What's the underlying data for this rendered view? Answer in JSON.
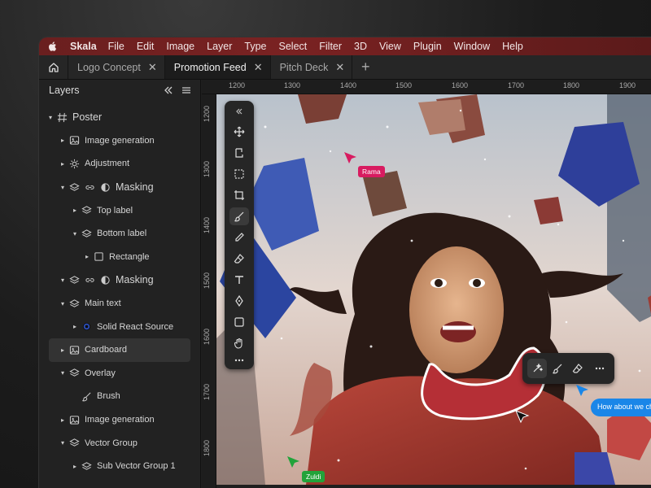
{
  "menubar": {
    "brand": "Skala",
    "items": [
      "File",
      "Edit",
      "Image",
      "Layer",
      "Type",
      "Select",
      "Filter",
      "3D",
      "View",
      "Plugin",
      "Window",
      "Help"
    ]
  },
  "tabs": [
    {
      "label": "Logo Concept",
      "active": false
    },
    {
      "label": "Promotion Feed",
      "active": true
    },
    {
      "label": "Pitch Deck",
      "active": false
    }
  ],
  "layers_panel": {
    "title": "Layers",
    "items": [
      {
        "label": "Poster",
        "icon": "hash-icon",
        "indent": 0,
        "caret": "▾"
      },
      {
        "label": "Image generation",
        "icon": "image-icon",
        "indent": 1,
        "caret": "▸"
      },
      {
        "label": "Adjustment",
        "icon": "sun-icon",
        "indent": 1,
        "caret": "▸"
      },
      {
        "label": "Masking",
        "icon": "mask-icon",
        "indent": 1,
        "caret": "▾"
      },
      {
        "label": "Top label",
        "icon": "stack-icon",
        "indent": 2,
        "caret": "▸"
      },
      {
        "label": "Bottom label",
        "icon": "stack-icon",
        "indent": 2,
        "caret": "▾"
      },
      {
        "label": "Rectangle",
        "icon": "square-icon",
        "indent": 3,
        "caret": "▸"
      },
      {
        "label": "Masking",
        "icon": "mask-icon",
        "indent": 1,
        "caret": "▾"
      },
      {
        "label": "Main text",
        "icon": "stack-icon",
        "indent": 1,
        "caret": "▾"
      },
      {
        "label": "Solid React Source",
        "icon": "dot-icon",
        "indent": 2,
        "caret": "▸"
      },
      {
        "label": "Cardboard",
        "icon": "image-icon",
        "indent": 1,
        "caret": "▸"
      },
      {
        "label": "Overlay",
        "icon": "stack-icon",
        "indent": 1,
        "caret": "▾"
      },
      {
        "label": "Brush",
        "icon": "brush-icon",
        "indent": 2,
        "caret": ""
      },
      {
        "label": "Image generation",
        "icon": "image-icon",
        "indent": 1,
        "caret": "▸"
      },
      {
        "label": "Vector Group",
        "icon": "stack-icon",
        "indent": 1,
        "caret": "▾"
      },
      {
        "label": "Sub Vector Group 1",
        "icon": "stack-icon",
        "indent": 2,
        "caret": "▸"
      }
    ]
  },
  "ruler": {
    "top": [
      "1200",
      "1300",
      "1400",
      "1500",
      "1600",
      "1700",
      "1800",
      "1900"
    ],
    "left": [
      "1200",
      "1300",
      "1400",
      "1500",
      "1600",
      "1700",
      "1800"
    ]
  },
  "collaborators": [
    {
      "name": "Rama",
      "color": "#d81b60"
    },
    {
      "name": "Zuldi",
      "color": "#22a33a"
    }
  ],
  "comment_bubble": "How about we ch",
  "colors": {
    "menubar": "#6e2020",
    "cursor_blue": "#1a86e8",
    "cursor_pink": "#d81b60",
    "cursor_green": "#22a33a"
  }
}
